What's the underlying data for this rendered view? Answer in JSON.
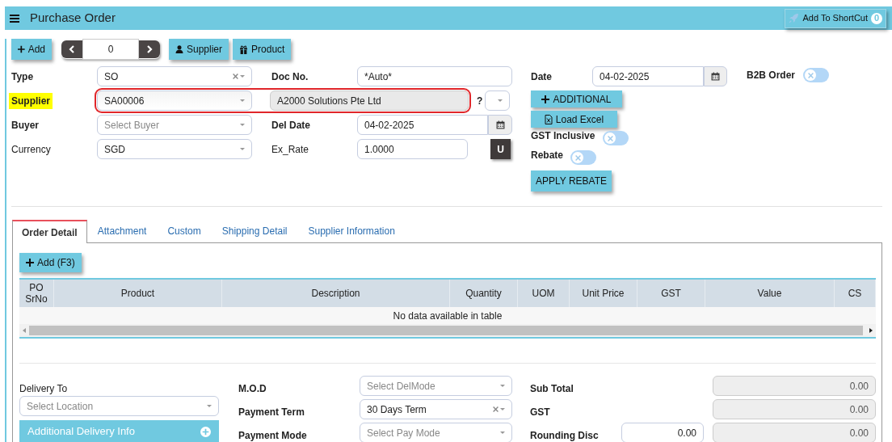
{
  "header": {
    "title": "Purchase Order",
    "shortcut_button": "Add To ShortCut",
    "shortcut_count": "0"
  },
  "toolbar": {
    "add": "Add",
    "record_number": "0",
    "supplier": "Supplier",
    "product": "Product"
  },
  "form": {
    "type": {
      "label": "Type",
      "value": "SO",
      "clearable": true
    },
    "doc_no": {
      "label": "Doc No.",
      "value": "*Auto*"
    },
    "supplier": {
      "label": "Supplier",
      "highlighted": true,
      "outlined": true,
      "code": "SA00006",
      "name": "A2000 Solutions Pte Ltd",
      "question": "?"
    },
    "buyer": {
      "label": "Buyer",
      "placeholder": "Select Buyer"
    },
    "del_date": {
      "label": "Del Date",
      "value": "04-02-2025"
    },
    "currency": {
      "label": "Currency",
      "value": "SGD"
    },
    "ex_rate": {
      "label": "Ex_Rate",
      "value": "1.0000",
      "button": "U"
    },
    "date": {
      "label": "Date",
      "value": "04-02-2025"
    },
    "additional_button": "ADDITIONAL",
    "load_excel_button": "Load Excel",
    "gst_inclusive": {
      "label": "GST Inclusive",
      "on": false
    },
    "rebate": {
      "label": "Rebate",
      "on": false
    },
    "apply_rebate_button": "APPLY REBATE",
    "b2b_order": {
      "label": "B2B Order",
      "on": false
    }
  },
  "tabs": [
    {
      "label": "Order Detail",
      "selected": true
    },
    {
      "label": "Attachment",
      "selected": false
    },
    {
      "label": "Custom",
      "selected": false
    },
    {
      "label": "Shipping Detail",
      "selected": false
    },
    {
      "label": "Supplier Information",
      "selected": false
    }
  ],
  "order_detail": {
    "add_button": "Add (F3)",
    "columns": [
      "PO SrNo",
      "Product",
      "Description",
      "Quantity",
      "UOM",
      "Unit Price",
      "GST",
      "Value",
      "CS"
    ],
    "empty_message": "No data available in table"
  },
  "delivery": {
    "label": "Delivery To",
    "placeholder": "Select Location",
    "info_bar": "Additional Delivery Info"
  },
  "terms": [
    {
      "label": "M.O.D",
      "placeholder": "Select DelMode"
    },
    {
      "label": "Payment Term",
      "value": "30 Days Term",
      "clearable": true
    },
    {
      "label": "Payment Mode",
      "placeholder": "Select Pay Mode"
    }
  ],
  "totals": [
    {
      "label": "Sub Total",
      "value": "0.00"
    },
    {
      "label": "GST",
      "value": "0.00"
    },
    {
      "label": "Rounding Disc",
      "adjustment": "0.00",
      "value": "0.00"
    }
  ]
}
